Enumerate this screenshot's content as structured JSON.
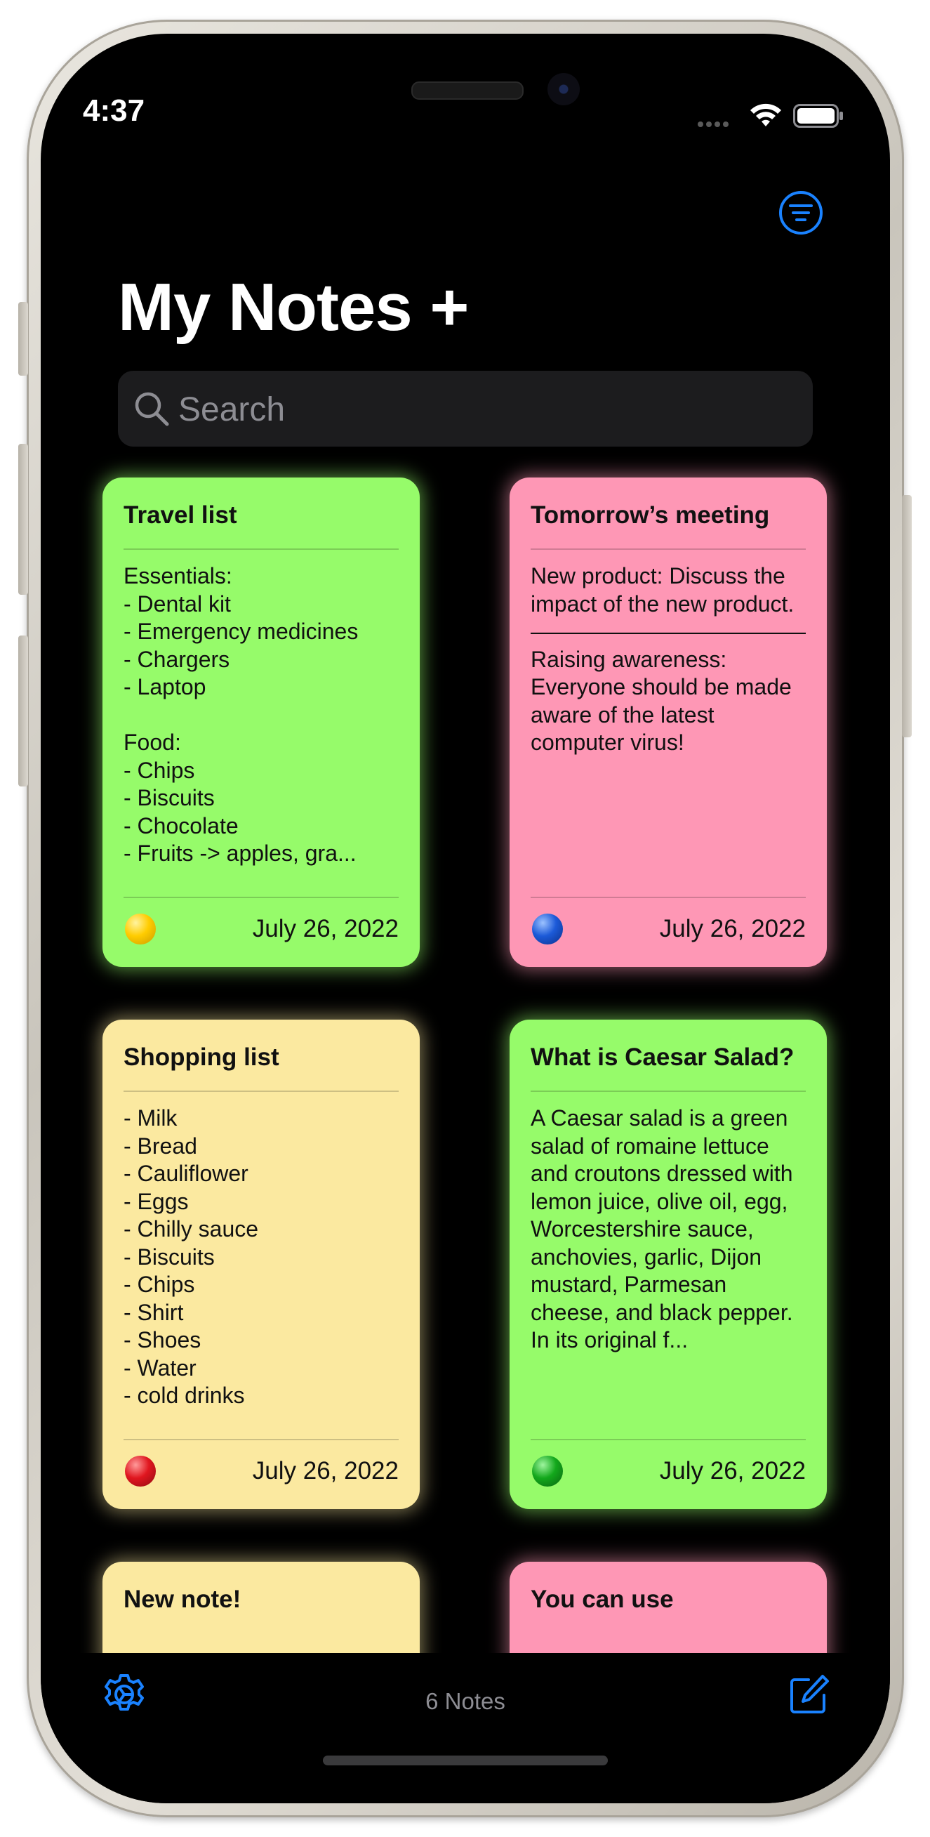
{
  "status_bar": {
    "time": "4:37"
  },
  "header": {
    "title": "My Notes +"
  },
  "search": {
    "placeholder": "Search"
  },
  "notes": [
    {
      "title": "Travel list",
      "body": "Essentials:\n- Dental kit\n- Emergency medicines\n- Chargers\n- Laptop\n\nFood:\n- Chips\n- Biscuits\n- Chocolate\n- Fruits -> apples, gra...",
      "date": "July 26, 2022",
      "color": "#96fb6a",
      "dot_color": "#ffcc00"
    },
    {
      "title": "Tomorrow’s meeting",
      "body": "New product: Discuss the impact of the new product.\n—————————————\nRaising awareness: Everyone should be made aware of the latest computer virus!",
      "date": "July 26, 2022",
      "color": "#fe97b5",
      "dot_color": "#1c5ad8"
    },
    {
      "title": "Shopping list",
      "body": "- Milk\n- Bread\n- Cauliflower\n- Eggs\n- Chilly sauce\n- Biscuits\n- Chips\n- Shirt\n- Shoes\n- Water\n- cold drinks",
      "date": "July 26, 2022",
      "color": "#fbe9a0",
      "dot_color": "#e0161f"
    },
    {
      "title": "What is Caesar Salad?",
      "body": "A Caesar salad is a green salad of romaine lettuce and croutons dressed with lemon juice, olive oil, egg, Worcestershire sauce, anchovies, garlic, Dijon mustard, Parmesan cheese, and black pepper. In its original f...",
      "date": "July 26, 2022",
      "color": "#96fb6a",
      "dot_color": "#13a81c"
    },
    {
      "title": "New note!",
      "body": "",
      "date": "",
      "color": "#fbe9a0",
      "dot_color": ""
    },
    {
      "title": "You can use",
      "body": "",
      "date": "",
      "color": "#fe97b5",
      "dot_color": ""
    }
  ],
  "footer": {
    "count_label": "6 Notes"
  },
  "colors": {
    "accent": "#1a82ff",
    "background": "#000000"
  },
  "icons": {
    "filter": "filter-circle-icon",
    "search": "search-icon",
    "settings": "gear-icon",
    "compose": "compose-icon"
  }
}
